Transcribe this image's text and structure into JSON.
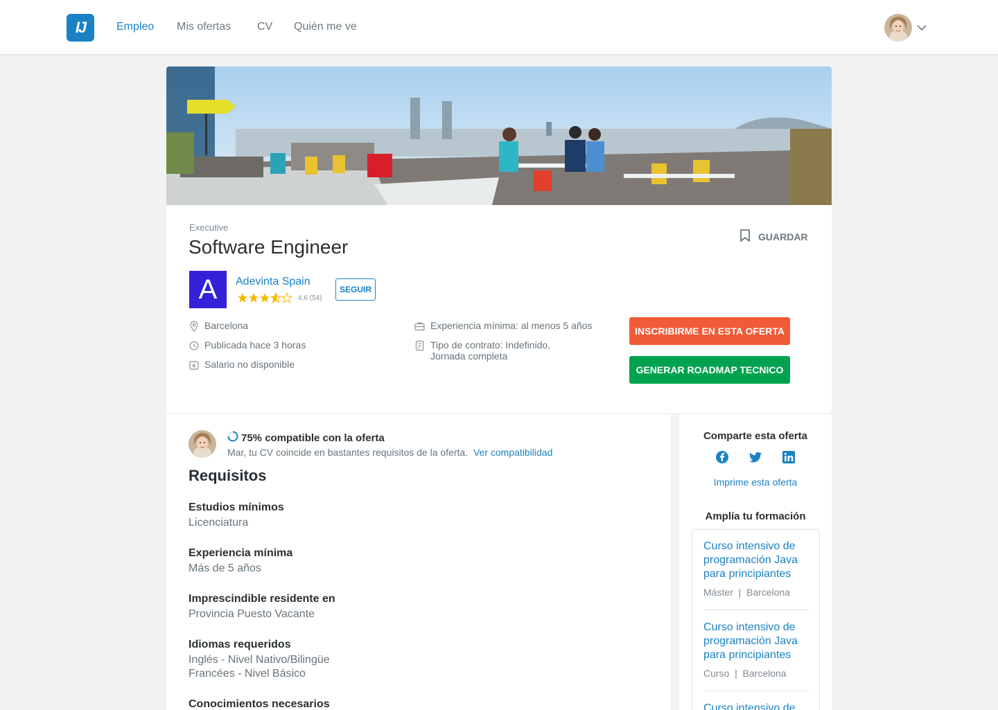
{
  "nav": {
    "logo_text": "IJ",
    "items": [
      {
        "label": "Empleo",
        "active": true
      },
      {
        "label": "Mis ofertas",
        "active": false
      },
      {
        "label": "CV",
        "active": false
      },
      {
        "label": "Quién me ve",
        "active": false
      }
    ]
  },
  "job": {
    "profile": "Executive",
    "title": "Software Engineer",
    "save_label": "GUARDAR",
    "company": {
      "logo_letter": "A",
      "name": "Adevinta Spain",
      "rating_text": "4,6 (54)",
      "rating_value": 4.6,
      "follow_label": "SEGUIR"
    },
    "info": {
      "location": "Barcelona",
      "published": "Publicada hace 3 horas",
      "salary": "Salario no disponible",
      "experience": "Experiencia mínima: al menos 5 años",
      "contract_line1": "Tipo de contrato: Indefinido,",
      "contract_line2": "Jornada completa"
    },
    "apply_label": "INSCRIBIRME EN ESTA OFERTA",
    "roadmap_label": "GENERAR ROADMAP TECNICO"
  },
  "compatibility": {
    "percent": 75,
    "title": "75% compatible con la oferta",
    "subtitle": "Mar, tu CV coincide en bastantes requisitos de la oferta.",
    "link": "Ver compatibilidad"
  },
  "requirements": {
    "heading": "Requisitos",
    "items": [
      {
        "label": "Estudios mínimos",
        "value": "Licenciatura"
      },
      {
        "label": "Experiencia mínima",
        "value": "Más de 5 años"
      },
      {
        "label": "Imprescindible residente en",
        "value": "Provincia Puesto Vacante"
      },
      {
        "label": "Idiomas requeridos",
        "value": "Inglés - Nivel Nativo/Bilingüe",
        "value2": "Francées - Nivel Básico"
      },
      {
        "label": "Conocimientos necesarios",
        "value": ""
      }
    ]
  },
  "sidebar": {
    "share_title": "Comparte esta oferta",
    "social_icons": [
      "facebook-icon",
      "twitter-icon",
      "linkedin-icon"
    ],
    "print_label": "Imprime esta oferta",
    "training_title": "Amplía tu formación",
    "courses": [
      {
        "title": "Curso intensivo de programación Java para principiantes",
        "meta": "Máster  |  Barcelona"
      },
      {
        "title": "Curso intensivo de programación Java para principiantes",
        "meta": "Curso  |  Barcelona"
      },
      {
        "title": "Curso intensivo de",
        "meta": ""
      }
    ]
  },
  "colors": {
    "brand": "#1a82c4",
    "apply": "#f05a36",
    "roadmap": "#00a24f",
    "company": "#3521d7",
    "star": "#f5b800"
  }
}
